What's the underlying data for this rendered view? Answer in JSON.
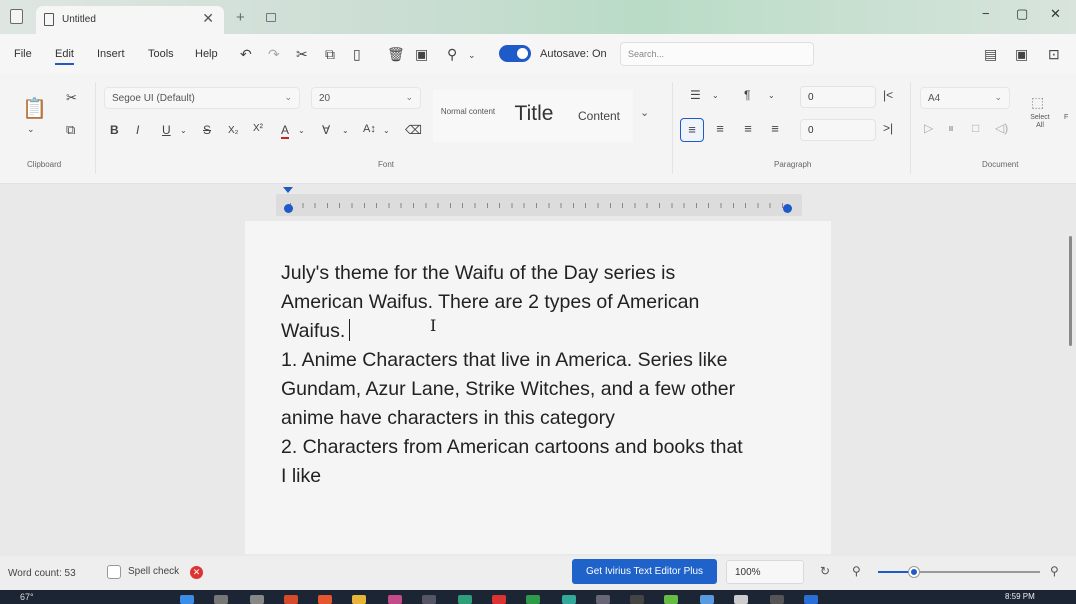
{
  "window": {
    "tab_title": "Untitled",
    "close_glyph": "✕",
    "new_tab_glyph": "+",
    "minimize_glyph": "−",
    "maximize_glyph": "▢",
    "close_window_glyph": "✕"
  },
  "menu": {
    "items": [
      "File",
      "Edit",
      "Insert",
      "Tools",
      "Help"
    ],
    "active": "Edit",
    "autosave_label": "Autosave: On",
    "autosave_on": true,
    "search_placeholder": "Search..."
  },
  "ribbon": {
    "font_family": "Segoe UI (Default)",
    "font_size": "20",
    "styles": {
      "normal": "Normal content",
      "title": "Title",
      "content": "Content"
    },
    "spacing_before": "0",
    "spacing_after": "0",
    "page_size": "A4",
    "select_all_label": "Select All",
    "groups": {
      "clipboard": "Clipboard",
      "font": "Font",
      "paragraph": "Paragraph",
      "document": "Document"
    }
  },
  "document": {
    "lines": [
      "July's theme for the Waifu of the Day series is",
      "American Waifus. There are 2 types of American",
      "Waifus.",
      "1. Anime Characters that live in America. Series like",
      "Gundam, Azur Lane, Strike Witches, and a few other",
      "anime have characters in this category",
      "2. Characters from American cartoons and books that",
      "I like"
    ]
  },
  "status": {
    "word_count": "Word count: 53",
    "spell_check_label": "Spell check",
    "spell_check_checked": false,
    "promo_button": "Get Ivirius Text Editor Plus",
    "zoom": "100%",
    "zoom_level_fraction": 0.22
  },
  "taskbar": {
    "weather": "67°",
    "time": "8:59 PM"
  },
  "colors": {
    "accent": "#1e5ac8",
    "promo": "#1f62c9",
    "error": "#dd3333"
  }
}
